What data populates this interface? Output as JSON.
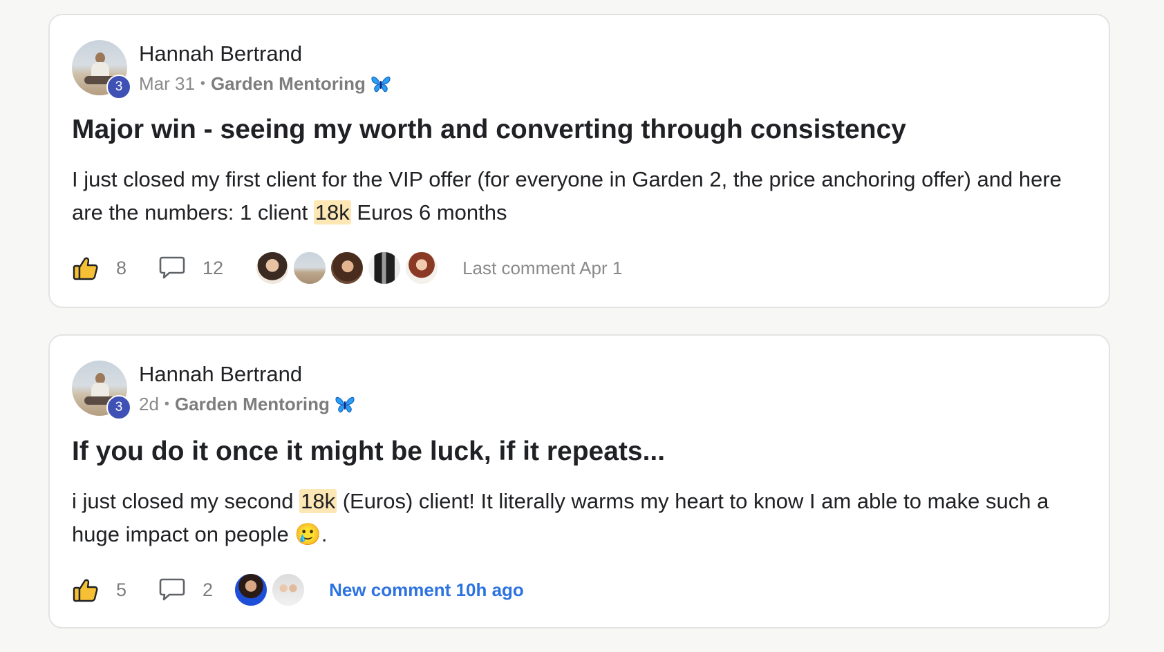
{
  "posts": [
    {
      "author": "Hannah Bertrand",
      "level": "3",
      "date": "Mar 31",
      "separator": "•",
      "category": "Garden Mentoring",
      "category_icon": "butterfly-icon",
      "title": "Major win - seeing my worth and converting through consistency",
      "body_before": "I just closed my first client for the VIP offer (for everyone in Garden 2, the price anchoring offer) and here are the numbers: 1 client ",
      "body_highlight": "18k",
      "body_after": " Euros 6 months",
      "likes": "8",
      "comments": "12",
      "commenter_avatars": [
        "avatar-woman-dark-hair",
        "avatar-hannah",
        "avatar-woman-curly-hair",
        "avatar-person-black-white",
        "avatar-woman-red-hair"
      ],
      "comment_status": "Last comment Apr 1"
    },
    {
      "author": "Hannah Bertrand",
      "level": "3",
      "date": "2d",
      "separator": "•",
      "category": "Garden Mentoring",
      "category_icon": "butterfly-icon",
      "title": "If you do it once it might be luck, if it repeats...",
      "body_before": "i just closed my second ",
      "body_highlight": "18k",
      "body_after": " (Euros) client! It literally warms my heart to know I am able to make such a huge impact on people 🥲.",
      "likes": "5",
      "comments": "2",
      "commenter_avatars": [
        "avatar-woman-blue-dress",
        "avatar-group-photo"
      ],
      "comment_status": "New comment 10h ago"
    }
  ],
  "colors": {
    "background": "#f7f7f6",
    "card": "#ffffff",
    "level_badge": "#3f51b5",
    "highlight": "#fde7b4",
    "new_comment": "#2c72e0",
    "butterfly": "#2a9df4",
    "like_icon": "#f5c033"
  }
}
